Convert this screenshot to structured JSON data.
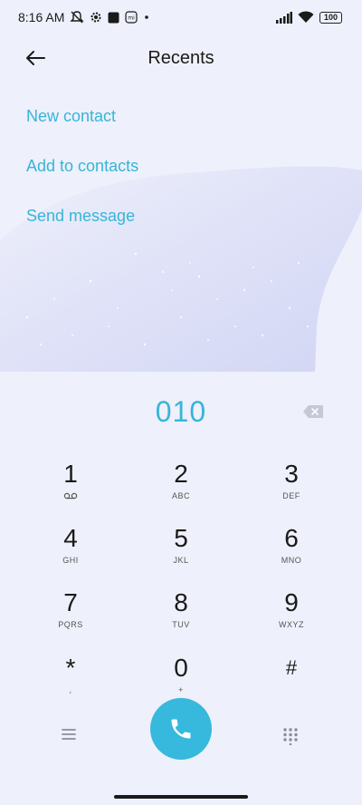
{
  "status_bar": {
    "time": "8:16 AM",
    "battery": "100",
    "icons": [
      "mute-icon",
      "settings-gear-icon",
      "square-app-icon",
      "mi-icon",
      "dot-icon",
      "signal-icon",
      "wifi-icon",
      "battery-icon"
    ]
  },
  "header": {
    "title": "Recents",
    "back_icon": "arrow-left-icon"
  },
  "actions": {
    "new_contact": "New contact",
    "add_to_contacts": "Add to contacts",
    "send_message": "Send message"
  },
  "dialer": {
    "number": "010",
    "backspace_icon": "backspace-icon",
    "keys": [
      {
        "digit": "1",
        "sub": ""
      },
      {
        "digit": "2",
        "sub": "ABC"
      },
      {
        "digit": "3",
        "sub": "DEF"
      },
      {
        "digit": "4",
        "sub": "GHI"
      },
      {
        "digit": "5",
        "sub": "JKL"
      },
      {
        "digit": "6",
        "sub": "MNO"
      },
      {
        "digit": "7",
        "sub": "PQRS"
      },
      {
        "digit": "8",
        "sub": "TUV"
      },
      {
        "digit": "9",
        "sub": "WXYZ"
      },
      {
        "digit": "*",
        "sub": ","
      },
      {
        "digit": "0",
        "sub": "+"
      },
      {
        "digit": "#",
        "sub": ""
      }
    ],
    "menu_icon": "menu-icon",
    "call_icon": "phone-icon",
    "keypad_icon": "keypad-icon"
  },
  "colors": {
    "accent": "#36b5d8",
    "background": "#eef0fb",
    "call_button": "#36b9dd"
  }
}
